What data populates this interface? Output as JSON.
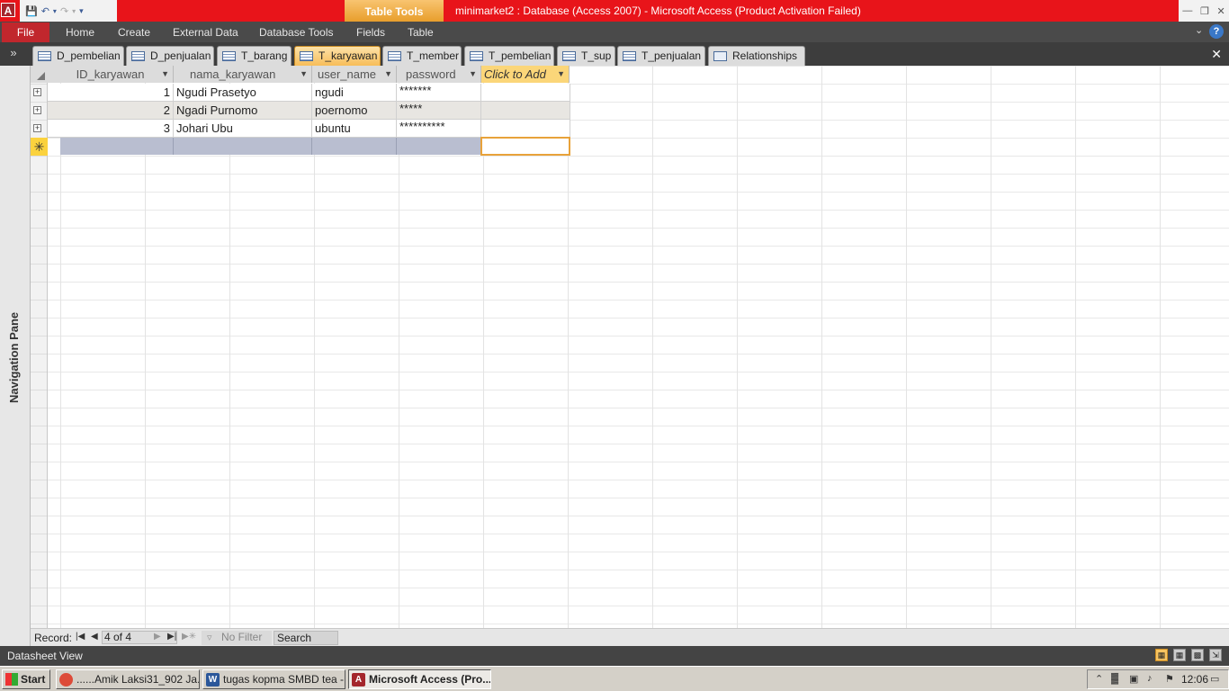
{
  "titlebar": {
    "app_icon": "A",
    "context_tab": "Table Tools",
    "title": "minimarket2 : Database (Access 2007)  -  Microsoft Access (Product Activation Failed)"
  },
  "ribbon": {
    "file": "File",
    "tabs": [
      "Home",
      "Create",
      "External Data",
      "Database Tools",
      "Fields",
      "Table"
    ]
  },
  "object_tabs": [
    {
      "label": "D_pembelian",
      "icon": "table-icon"
    },
    {
      "label": "D_penjualan",
      "icon": "table-icon"
    },
    {
      "label": "T_barang",
      "icon": "table-icon"
    },
    {
      "label": "T_karyawan",
      "icon": "table-icon",
      "active": true
    },
    {
      "label": "T_member",
      "icon": "table-icon"
    },
    {
      "label": "T_pembelian",
      "icon": "table-icon"
    },
    {
      "label": "T_sup",
      "icon": "table-icon"
    },
    {
      "label": "T_penjualan",
      "icon": "table-icon"
    },
    {
      "label": "Relationships",
      "icon": "relationships-icon"
    }
  ],
  "nav_pane": {
    "label": "Navigation Pane",
    "toggle": "»"
  },
  "table": {
    "columns": [
      "ID_karyawan",
      "nama_karyawan",
      "user_name",
      "password",
      "Click to Add"
    ],
    "rows": [
      {
        "id": "1",
        "nama": "Ngudi Prasetyo",
        "user": "ngudi",
        "pass": "*******"
      },
      {
        "id": "2",
        "nama": "Ngadi Purnomo",
        "user": "poernomo",
        "pass": "*****"
      },
      {
        "id": "3",
        "nama": "Johari Ubu",
        "user": "ubuntu",
        "pass": "**********"
      }
    ],
    "new_row_marker": "✳"
  },
  "record_nav": {
    "label": "Record:",
    "current": "4 of 4",
    "filter": "No Filter",
    "search": "Search"
  },
  "status": {
    "text": "Datasheet View"
  },
  "taskbar": {
    "start": "Start",
    "tasks": [
      {
        "label": "......Amik Laksi31_902 Ja...",
        "icon": "chrome-icon"
      },
      {
        "label": "tugas kopma SMBD tea - ...",
        "icon": "word-icon"
      },
      {
        "label": "Microsoft Access (Pro...",
        "icon": "access-icon",
        "active": true
      }
    ],
    "clock": "12:06"
  },
  "colors": {
    "title_red": "#e8141a",
    "file_tab": "#c1272d",
    "active_tab": "#f7bd59",
    "new_row_fill": "#b9bed0"
  }
}
